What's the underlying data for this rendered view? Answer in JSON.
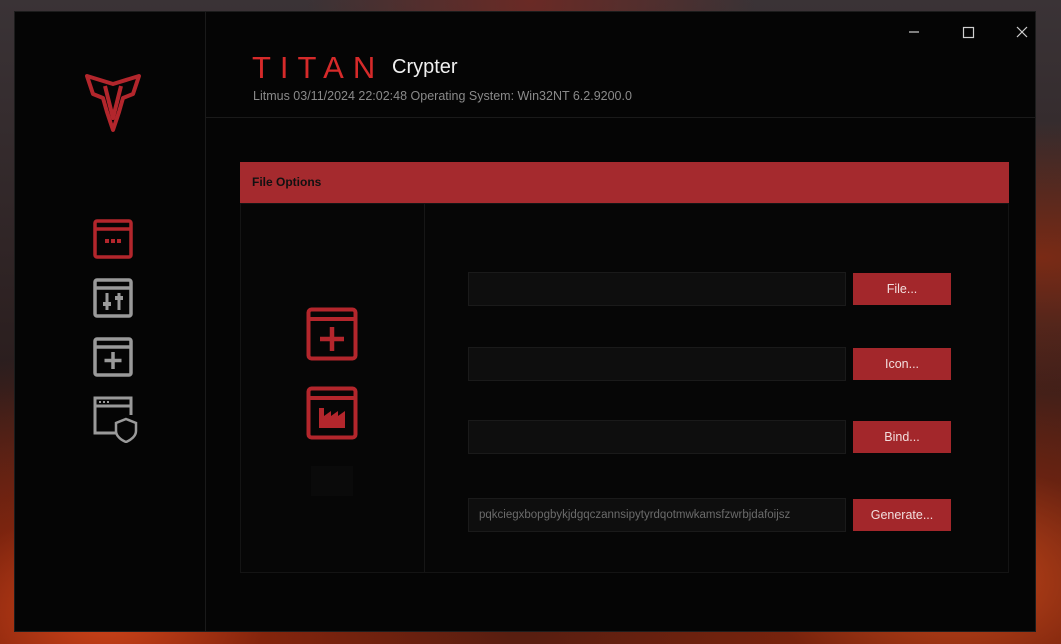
{
  "app": {
    "brand": "TITAN",
    "subtitle": "Crypter",
    "status_line": "Litmus 03/11/2024 22:02:48 Operating System: Win32NT 6.2.9200.0"
  },
  "window_controls": {
    "minimize": "—",
    "maximize": "☐",
    "close": "✕"
  },
  "colors": {
    "accent": "#a52a2e",
    "brand_red": "#d62a2a",
    "icon_gray": "#9a9a9a",
    "background": "#050505"
  },
  "sidebar": {
    "items": [
      {
        "icon": "window-dots-icon",
        "active": true
      },
      {
        "icon": "sliders-icon",
        "active": false
      },
      {
        "icon": "add-box-icon",
        "active": false
      },
      {
        "icon": "window-shield-icon",
        "active": false
      }
    ]
  },
  "panel": {
    "title": "File Options",
    "left_icons": [
      "add-box-icon",
      "factory-icon"
    ],
    "rows": [
      {
        "value": "",
        "button": "File..."
      },
      {
        "value": "",
        "button": "Icon..."
      },
      {
        "value": "",
        "button": "Bind..."
      },
      {
        "value": "pqkciegxbopgbykjdgqczannsipytyrdqotmwkamsfzwrbjdafoijsz",
        "button": "Generate..."
      }
    ]
  }
}
